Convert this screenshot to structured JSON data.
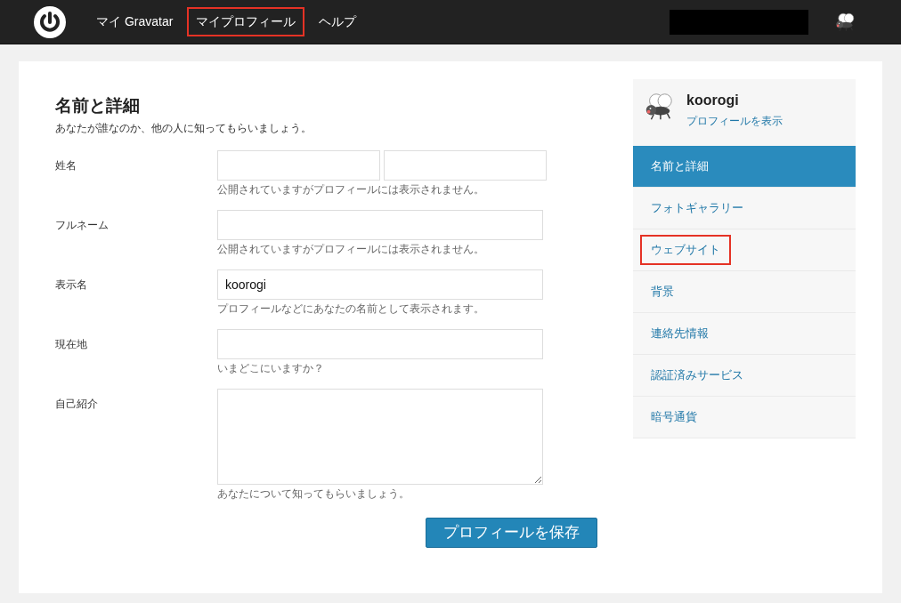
{
  "nav": {
    "items": [
      {
        "label": "マイ Gravatar",
        "highlighted": false
      },
      {
        "label": "マイプロフィール",
        "highlighted": true
      },
      {
        "label": "ヘルプ",
        "highlighted": false
      }
    ]
  },
  "form": {
    "title": "名前と詳細",
    "subtitle": "あなたが誰なのか、他の人に知ってもらいましょう。",
    "fields": [
      {
        "kind": "split",
        "label": "姓名",
        "hint": "公開されていますがプロフィールには表示されません。"
      },
      {
        "kind": "text",
        "label": "フルネーム",
        "hint": "公開されていますがプロフィールには表示されません。"
      },
      {
        "kind": "text",
        "label": "表示名",
        "value": "koorogi",
        "hint": "プロフィールなどにあなたの名前として表示されます。"
      },
      {
        "kind": "text",
        "label": "現在地",
        "hint": "いまどこにいますか？"
      },
      {
        "kind": "textarea",
        "label": "自己紹介",
        "hint": "あなたについて知ってもらいましょう。"
      }
    ],
    "save_button": "プロフィールを保存"
  },
  "sidebar": {
    "username": "koorogi",
    "view_profile": "プロフィールを表示",
    "items": [
      {
        "label": "名前と詳細",
        "selected": true,
        "highlighted": false
      },
      {
        "label": "フォトギャラリー",
        "selected": false,
        "highlighted": false
      },
      {
        "label": "ウェブサイト",
        "selected": false,
        "highlighted": true
      },
      {
        "label": "背景",
        "selected": false,
        "highlighted": false
      },
      {
        "label": "連絡先情報",
        "selected": false,
        "highlighted": false
      },
      {
        "label": "認証済みサービス",
        "selected": false,
        "highlighted": false
      },
      {
        "label": "暗号通貨",
        "selected": false,
        "highlighted": false
      }
    ]
  }
}
